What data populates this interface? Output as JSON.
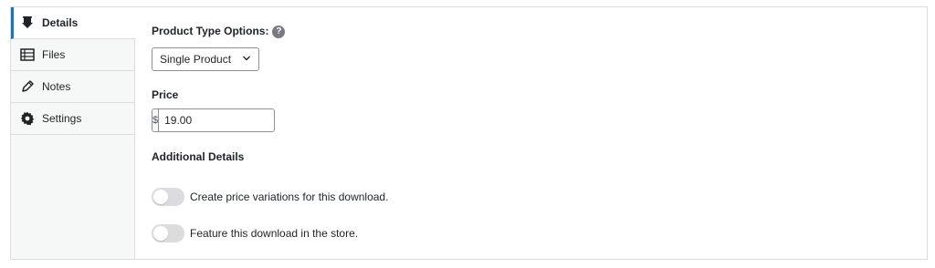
{
  "tabs": [
    {
      "label": "Details",
      "icon": "download-icon",
      "active": true
    },
    {
      "label": "Files",
      "icon": "list-icon",
      "active": false
    },
    {
      "label": "Notes",
      "icon": "pencil-icon",
      "active": false
    },
    {
      "label": "Settings",
      "icon": "gear-icon",
      "active": false
    }
  ],
  "details": {
    "product_type_label": "Product Type Options:",
    "help_glyph": "?",
    "product_type_value": "Single Product",
    "price_label": "Price",
    "currency_symbol": "$",
    "price_value": "19.00",
    "additional_label": "Additional Details",
    "toggle_variations_label": "Create price variations for this download.",
    "toggle_feature_label": "Feature this download in the store.",
    "toggle_variations_on": false,
    "toggle_feature_on": false
  },
  "colors": {
    "accent": "#2271b1",
    "toggle_off": "#dcdcde"
  }
}
